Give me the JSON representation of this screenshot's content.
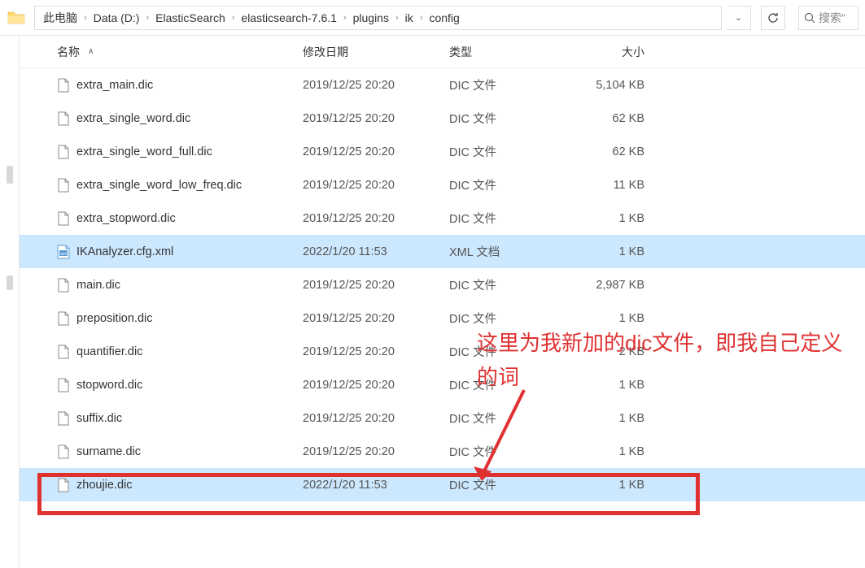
{
  "breadcrumb": {
    "items": [
      "此电脑",
      "Data (D:)",
      "ElasticSearch",
      "elasticsearch-7.6.1",
      "plugins",
      "ik",
      "config"
    ]
  },
  "search": {
    "placeholder": "搜索\""
  },
  "columns": {
    "name": "名称",
    "date": "修改日期",
    "type": "类型",
    "size": "大小"
  },
  "files": [
    {
      "name": "extra_main.dic",
      "date": "2019/12/25 20:20",
      "type": "DIC 文件",
      "size": "5,104 KB",
      "icon": "doc"
    },
    {
      "name": "extra_single_word.dic",
      "date": "2019/12/25 20:20",
      "type": "DIC 文件",
      "size": "62 KB",
      "icon": "doc"
    },
    {
      "name": "extra_single_word_full.dic",
      "date": "2019/12/25 20:20",
      "type": "DIC 文件",
      "size": "62 KB",
      "icon": "doc"
    },
    {
      "name": "extra_single_word_low_freq.dic",
      "date": "2019/12/25 20:20",
      "type": "DIC 文件",
      "size": "11 KB",
      "icon": "doc"
    },
    {
      "name": "extra_stopword.dic",
      "date": "2019/12/25 20:20",
      "type": "DIC 文件",
      "size": "1 KB",
      "icon": "doc"
    },
    {
      "name": "IKAnalyzer.cfg.xml",
      "date": "2022/1/20 11:53",
      "type": "XML 文档",
      "size": "1 KB",
      "icon": "xml",
      "selected": true
    },
    {
      "name": "main.dic",
      "date": "2019/12/25 20:20",
      "type": "DIC 文件",
      "size": "2,987 KB",
      "icon": "doc"
    },
    {
      "name": "preposition.dic",
      "date": "2019/12/25 20:20",
      "type": "DIC 文件",
      "size": "1 KB",
      "icon": "doc"
    },
    {
      "name": "quantifier.dic",
      "date": "2019/12/25 20:20",
      "type": "DIC 文件",
      "size": "2 KB",
      "icon": "doc"
    },
    {
      "name": "stopword.dic",
      "date": "2019/12/25 20:20",
      "type": "DIC 文件",
      "size": "1 KB",
      "icon": "doc"
    },
    {
      "name": "suffix.dic",
      "date": "2019/12/25 20:20",
      "type": "DIC 文件",
      "size": "1 KB",
      "icon": "doc"
    },
    {
      "name": "surname.dic",
      "date": "2019/12/25 20:20",
      "type": "DIC 文件",
      "size": "1 KB",
      "icon": "doc"
    },
    {
      "name": "zhoujie.dic",
      "date": "2022/1/20 11:53",
      "type": "DIC 文件",
      "size": "1 KB",
      "icon": "doc",
      "selected": true
    }
  ],
  "annotation": {
    "text": "这里为我新加的dic文件，即我自己定义的词"
  }
}
